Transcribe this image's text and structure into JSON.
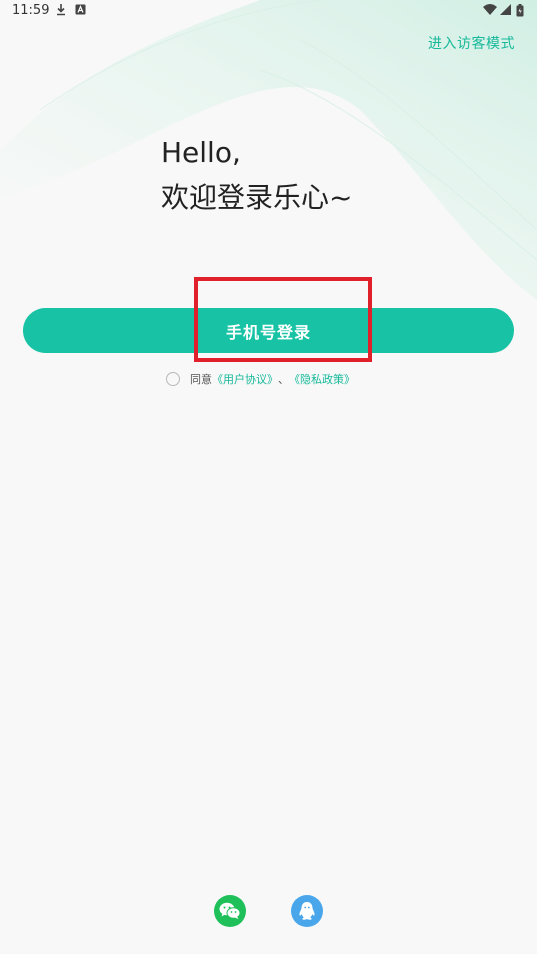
{
  "status_bar": {
    "time": "11:59"
  },
  "header": {
    "guest_link": "进入访客模式"
  },
  "greeting": {
    "line1": "Hello,",
    "line2": "欢迎登录乐心~"
  },
  "login": {
    "phone_button_label": "手机号登录"
  },
  "agreement": {
    "prefix": "同意",
    "user_agreement": "《用户协议》",
    "separator": "、",
    "privacy_policy": "《隐私政策》"
  },
  "social": {
    "icons": [
      "wechat-icon",
      "qq-icon"
    ]
  },
  "colors": {
    "accent": "#17c3a4",
    "link": "#16b99a",
    "highlight": "#e0202b",
    "wechat": "#1fc05a",
    "qq": "#4aa6ea"
  }
}
